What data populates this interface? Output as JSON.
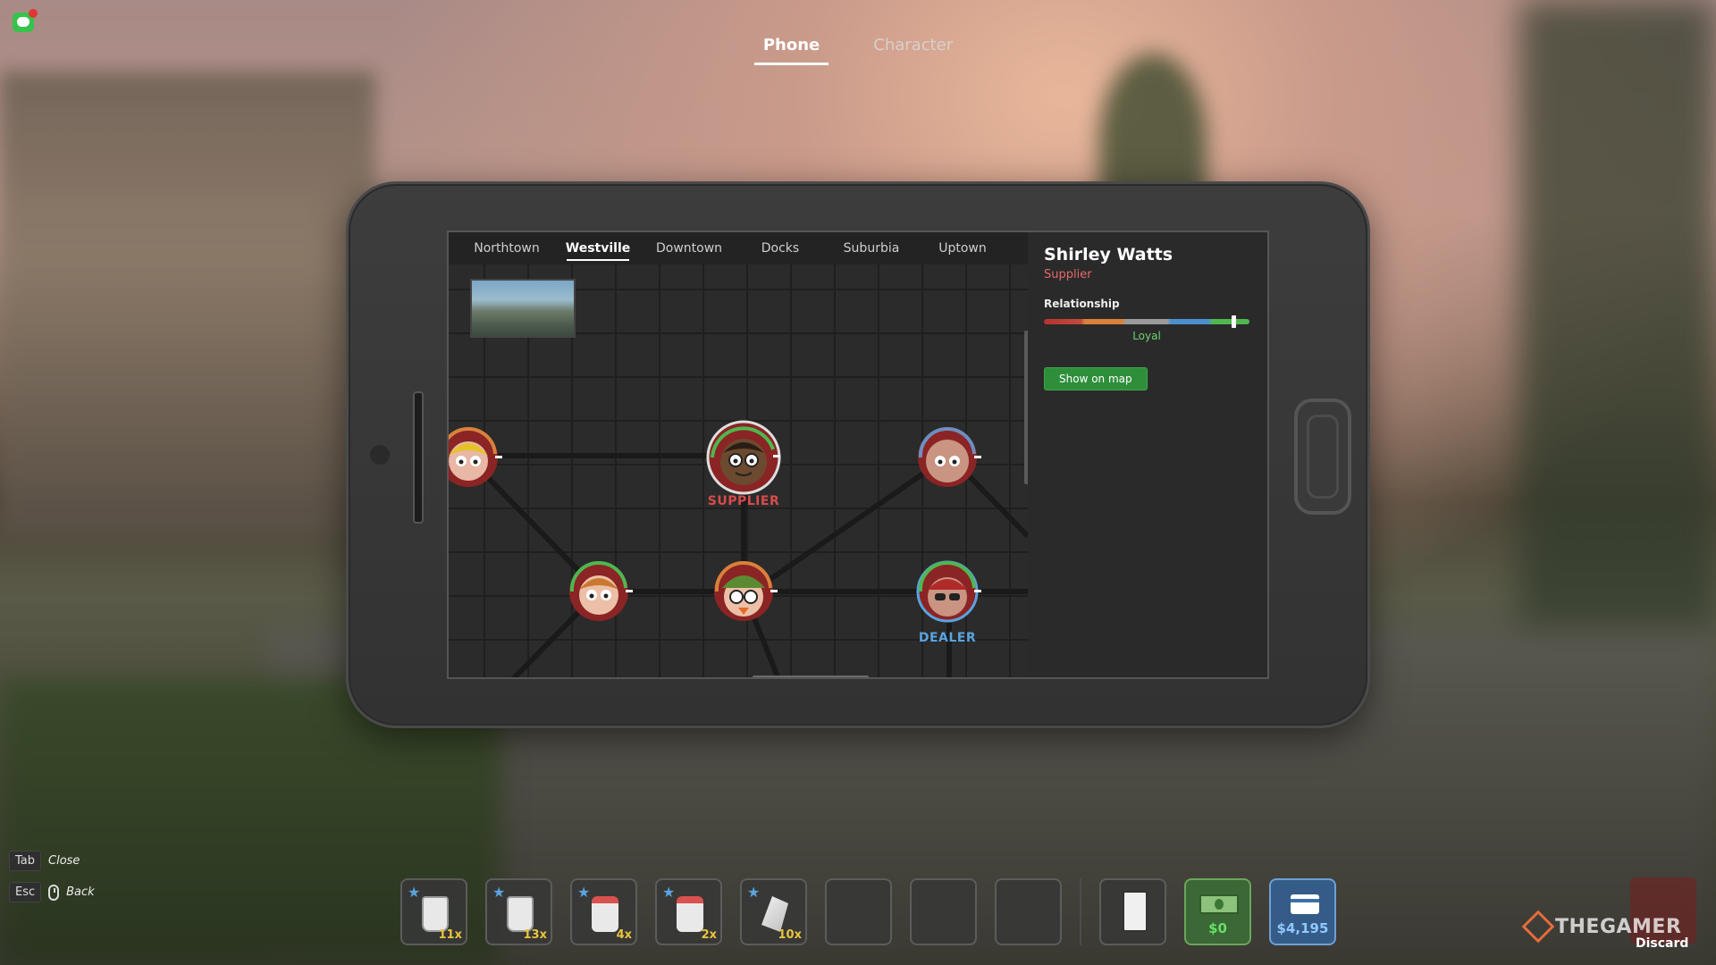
{
  "top_tabs": [
    {
      "label": "Phone",
      "active": true
    },
    {
      "label": "Character",
      "active": false
    }
  ],
  "regions": [
    "Northtown",
    "Westville",
    "Downtown",
    "Docks",
    "Suburbia",
    "Uptown"
  ],
  "active_region": "Westville",
  "network": {
    "labels": {
      "supplier": "SUPPLIER",
      "dealer": "DEALER"
    }
  },
  "contact": {
    "name": "Shirley Watts",
    "role": "Supplier",
    "relationship_title": "Relationship",
    "relationship_level": "Loyal",
    "relationship_value": 0.92,
    "show_on_map": "Show on map"
  },
  "hints": [
    {
      "key": "Tab",
      "action": "Close"
    },
    {
      "key": "Esc",
      "action": "Back"
    }
  ],
  "hotbar": [
    {
      "qty": "11x",
      "starred": true,
      "kind": "bag"
    },
    {
      "qty": "13x",
      "starred": true,
      "kind": "bag"
    },
    {
      "qty": "4x",
      "starred": true,
      "kind": "jar"
    },
    {
      "qty": "2x",
      "starred": true,
      "kind": "jar"
    },
    {
      "qty": "10x",
      "starred": true,
      "kind": "crystal"
    },
    {
      "qty": "",
      "starred": false,
      "kind": "empty"
    },
    {
      "qty": "",
      "starred": false,
      "kind": "empty"
    },
    {
      "qty": "",
      "starred": false,
      "kind": "empty"
    }
  ],
  "cash": "$0",
  "bank": "$4,195",
  "discard_label": "Discard",
  "watermark": "THEGAMER",
  "colors": {
    "supplier": "#d84b4b",
    "dealer": "#5aa3e0",
    "accent_green": "#2e8e3a"
  }
}
